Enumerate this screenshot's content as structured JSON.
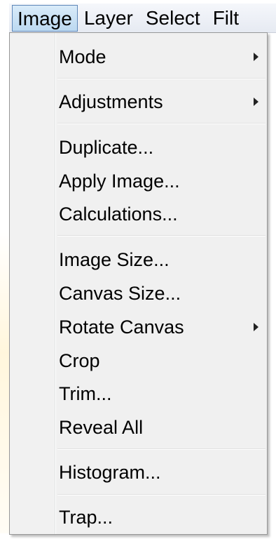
{
  "menubar": {
    "items": [
      {
        "label": "Image"
      },
      {
        "label": "Layer"
      },
      {
        "label": "Select"
      },
      {
        "label": "Filt"
      }
    ]
  },
  "image_menu": {
    "items": [
      {
        "label": "Mode",
        "has_submenu": true
      },
      {
        "label": "Adjustments",
        "has_submenu": true
      },
      {
        "label": "Duplicate..."
      },
      {
        "label": "Apply Image..."
      },
      {
        "label": "Calculations..."
      },
      {
        "label": "Image Size..."
      },
      {
        "label": "Canvas Size..."
      },
      {
        "label": "Rotate Canvas",
        "has_submenu": true
      },
      {
        "label": "Crop"
      },
      {
        "label": "Trim..."
      },
      {
        "label": "Reveal All"
      },
      {
        "label": "Histogram..."
      },
      {
        "label": "Trap..."
      }
    ]
  },
  "icons": {
    "submenu": "chevron-right-icon"
  }
}
